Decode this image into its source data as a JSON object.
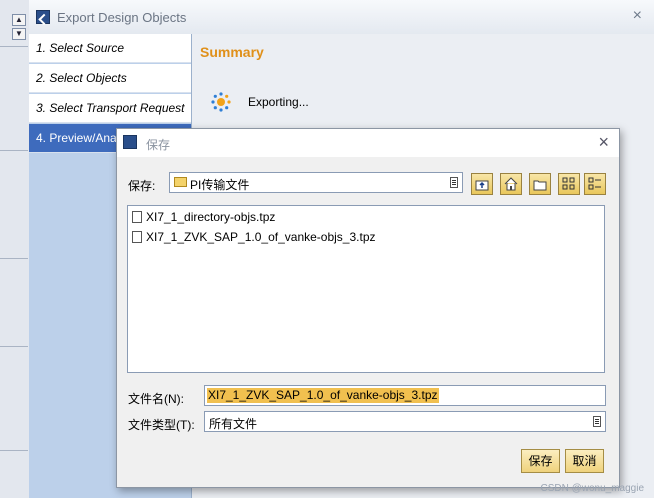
{
  "window": {
    "title": "Export Design Objects",
    "close": "×"
  },
  "steps": [
    {
      "label": "1. Select Source"
    },
    {
      "label": "2. Select Objects"
    },
    {
      "label": "3. Select Transport Request"
    },
    {
      "label": "4. Preview/Analyze"
    }
  ],
  "content": {
    "heading": "Summary",
    "status": "Exporting..."
  },
  "dialog": {
    "title": "保存",
    "close": "×",
    "save_in_label": "保存:",
    "save_in_value": "PI传输文件",
    "toolbar_icons": [
      "up-one-level-icon",
      "home-icon",
      "new-folder-icon",
      "list-view-icon",
      "details-view-icon"
    ],
    "files": [
      {
        "name": "XI7_1_directory-objs.tpz"
      },
      {
        "name": "XI7_1_ZVK_SAP_1.0_of_vanke-objs_3.tpz"
      }
    ],
    "filename_label": "文件名(N):",
    "filename_value": "XI7_1_ZVK_SAP_1.0_of_vanke-objs_3.tpz",
    "filetype_label": "文件类型(T):",
    "filetype_value": "所有文件",
    "save_button": "保存",
    "cancel_button": "取消"
  },
  "footer_watermark": "CSDN @wonu_maggie"
}
